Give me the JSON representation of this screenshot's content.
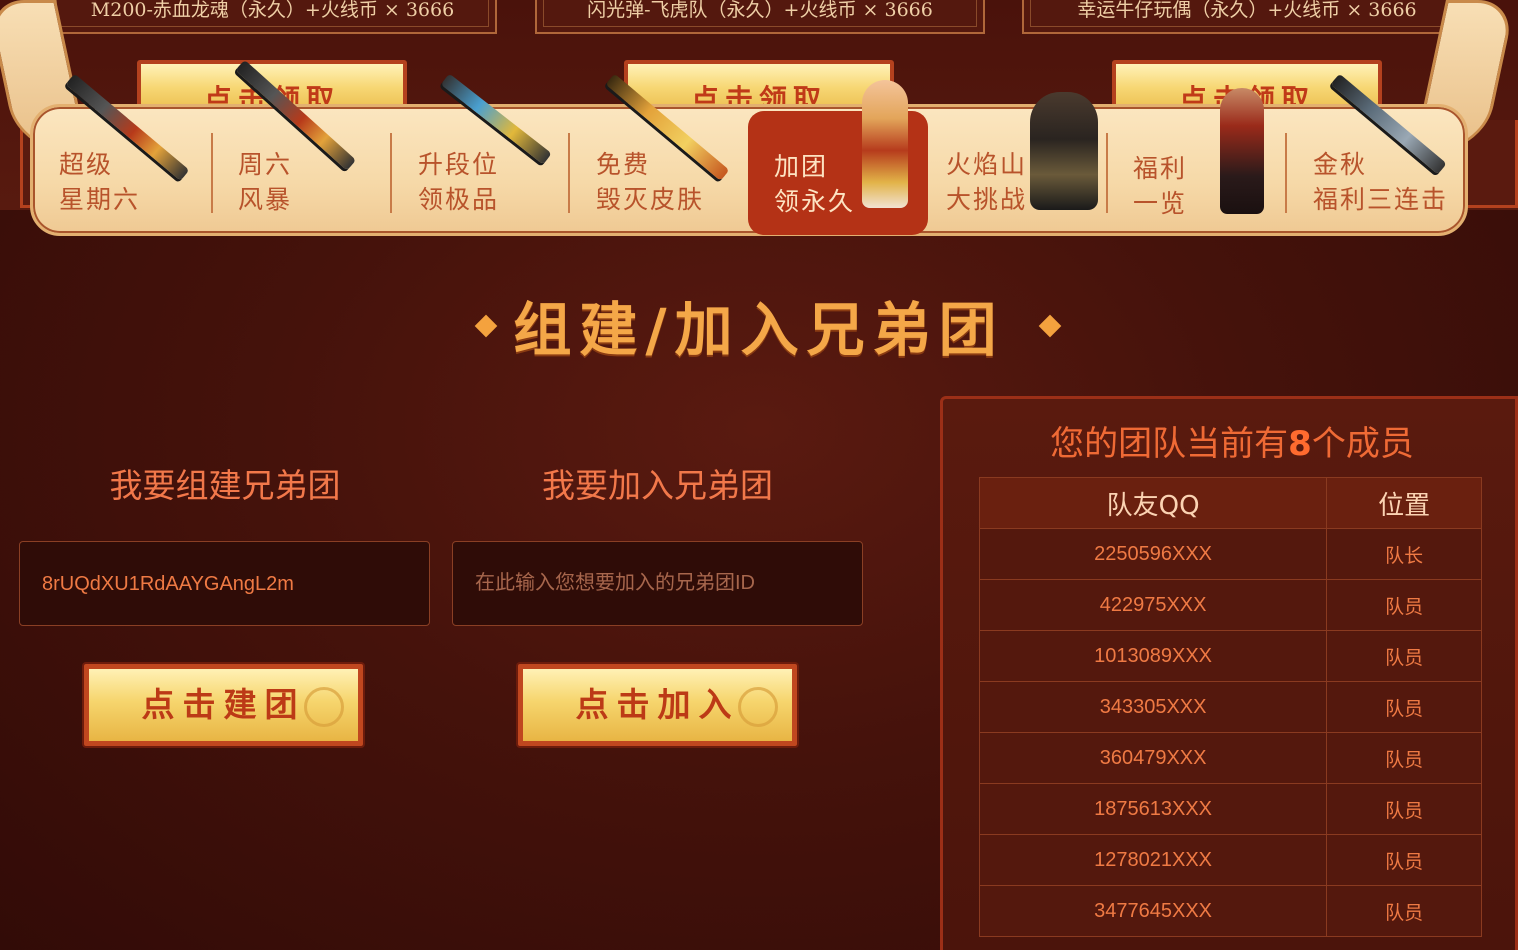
{
  "rewards": [
    {
      "name": "M200-赤血龙魂（永久）+火线币 × 3666",
      "button": "点击领取"
    },
    {
      "name": "闪光弹-飞虎队（永久）+火线币 × 3666",
      "button": "点击领取"
    },
    {
      "name": "幸运牛仔玩偶（永久）+火线币 × 3666",
      "button": "点击领取"
    }
  ],
  "nav": [
    {
      "line1": "超级",
      "line2": "星期六",
      "active": false
    },
    {
      "line1": "周六",
      "line2": "风暴",
      "active": false
    },
    {
      "line1": "升段位",
      "line2": "领极品",
      "active": false
    },
    {
      "line1": "免费",
      "line2": "毁灭皮肤",
      "active": false
    },
    {
      "line1": "加团",
      "line2": "领永久",
      "active": true
    },
    {
      "line1": "火焰山",
      "line2": "大挑战",
      "active": false
    },
    {
      "line1": "福利",
      "line2": "一览",
      "active": false
    },
    {
      "line1": "金秋",
      "line2": "福利三连击",
      "active": false
    }
  ],
  "section": {
    "title": "组建/加入兄弟团"
  },
  "create": {
    "title": "我要组建兄弟团",
    "team_id": "8rUQdXU1RdAAYGAngL2m",
    "button": "点击建团"
  },
  "join": {
    "title": "我要加入兄弟团",
    "placeholder": "在此输入您想要加入的兄弟团ID",
    "button": "点击加入"
  },
  "team": {
    "heading_prefix": "您的团队当前有",
    "count": "8",
    "heading_suffix": "个成员",
    "columns": [
      "队友QQ",
      "位置"
    ],
    "members": [
      {
        "qq": "2250596XXX",
        "role": "队长"
      },
      {
        "qq": "422975XXX",
        "role": "队员"
      },
      {
        "qq": "1013089XXX",
        "role": "队员"
      },
      {
        "qq": "343305XXX",
        "role": "队员"
      },
      {
        "qq": "360479XXX",
        "role": "队员"
      },
      {
        "qq": "1875613XXX",
        "role": "队员"
      },
      {
        "qq": "1278021XXX",
        "role": "队员"
      },
      {
        "qq": "3477645XXX",
        "role": "队员"
      }
    ]
  },
  "colors": {
    "accent": "#f4a748",
    "button_gold": "#f6d56d",
    "active_tab": "#b43216",
    "text_orange": "#ef7a44"
  }
}
